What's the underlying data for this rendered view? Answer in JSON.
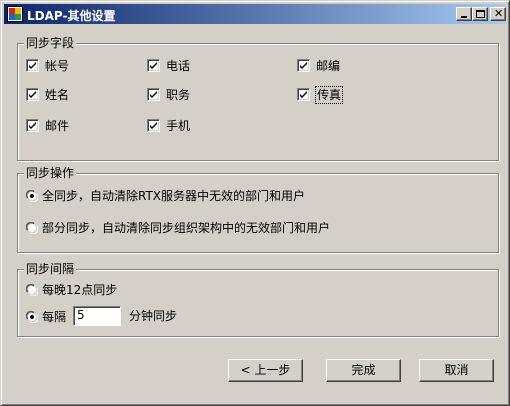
{
  "window": {
    "title": "LDAP-其他设置",
    "icon": "app-icon",
    "controls": [
      "minimize-icon",
      "maximize-icon",
      "close-icon"
    ]
  },
  "sync_fields": {
    "legend": "同步字段",
    "items": [
      {
        "label": "帐号",
        "checked": true
      },
      {
        "label": "电话",
        "checked": true
      },
      {
        "label": "邮编",
        "checked": true
      },
      {
        "label": "姓名",
        "checked": true
      },
      {
        "label": "职务",
        "checked": true
      },
      {
        "label": "传真",
        "checked": true
      },
      {
        "label": "邮件",
        "checked": true
      },
      {
        "label": "手机",
        "checked": true
      }
    ]
  },
  "sync_operation": {
    "legend": "同步操作",
    "options": [
      {
        "label": "全同步，自动清除RTX服务器中无效的部门和用户",
        "selected": true
      },
      {
        "label": "部分同步，自动清除同步组织架构中的无效部门和用户",
        "selected": false
      }
    ]
  },
  "sync_interval": {
    "legend": "同步间隔",
    "nightly": {
      "label": "每晚12点同步",
      "selected": false
    },
    "every": {
      "label": "每隔",
      "selected": true,
      "value": "5",
      "suffix": "分钟同步"
    }
  },
  "buttons": {
    "prev": "< 上一步",
    "finish": "完成",
    "cancel": "取消"
  }
}
